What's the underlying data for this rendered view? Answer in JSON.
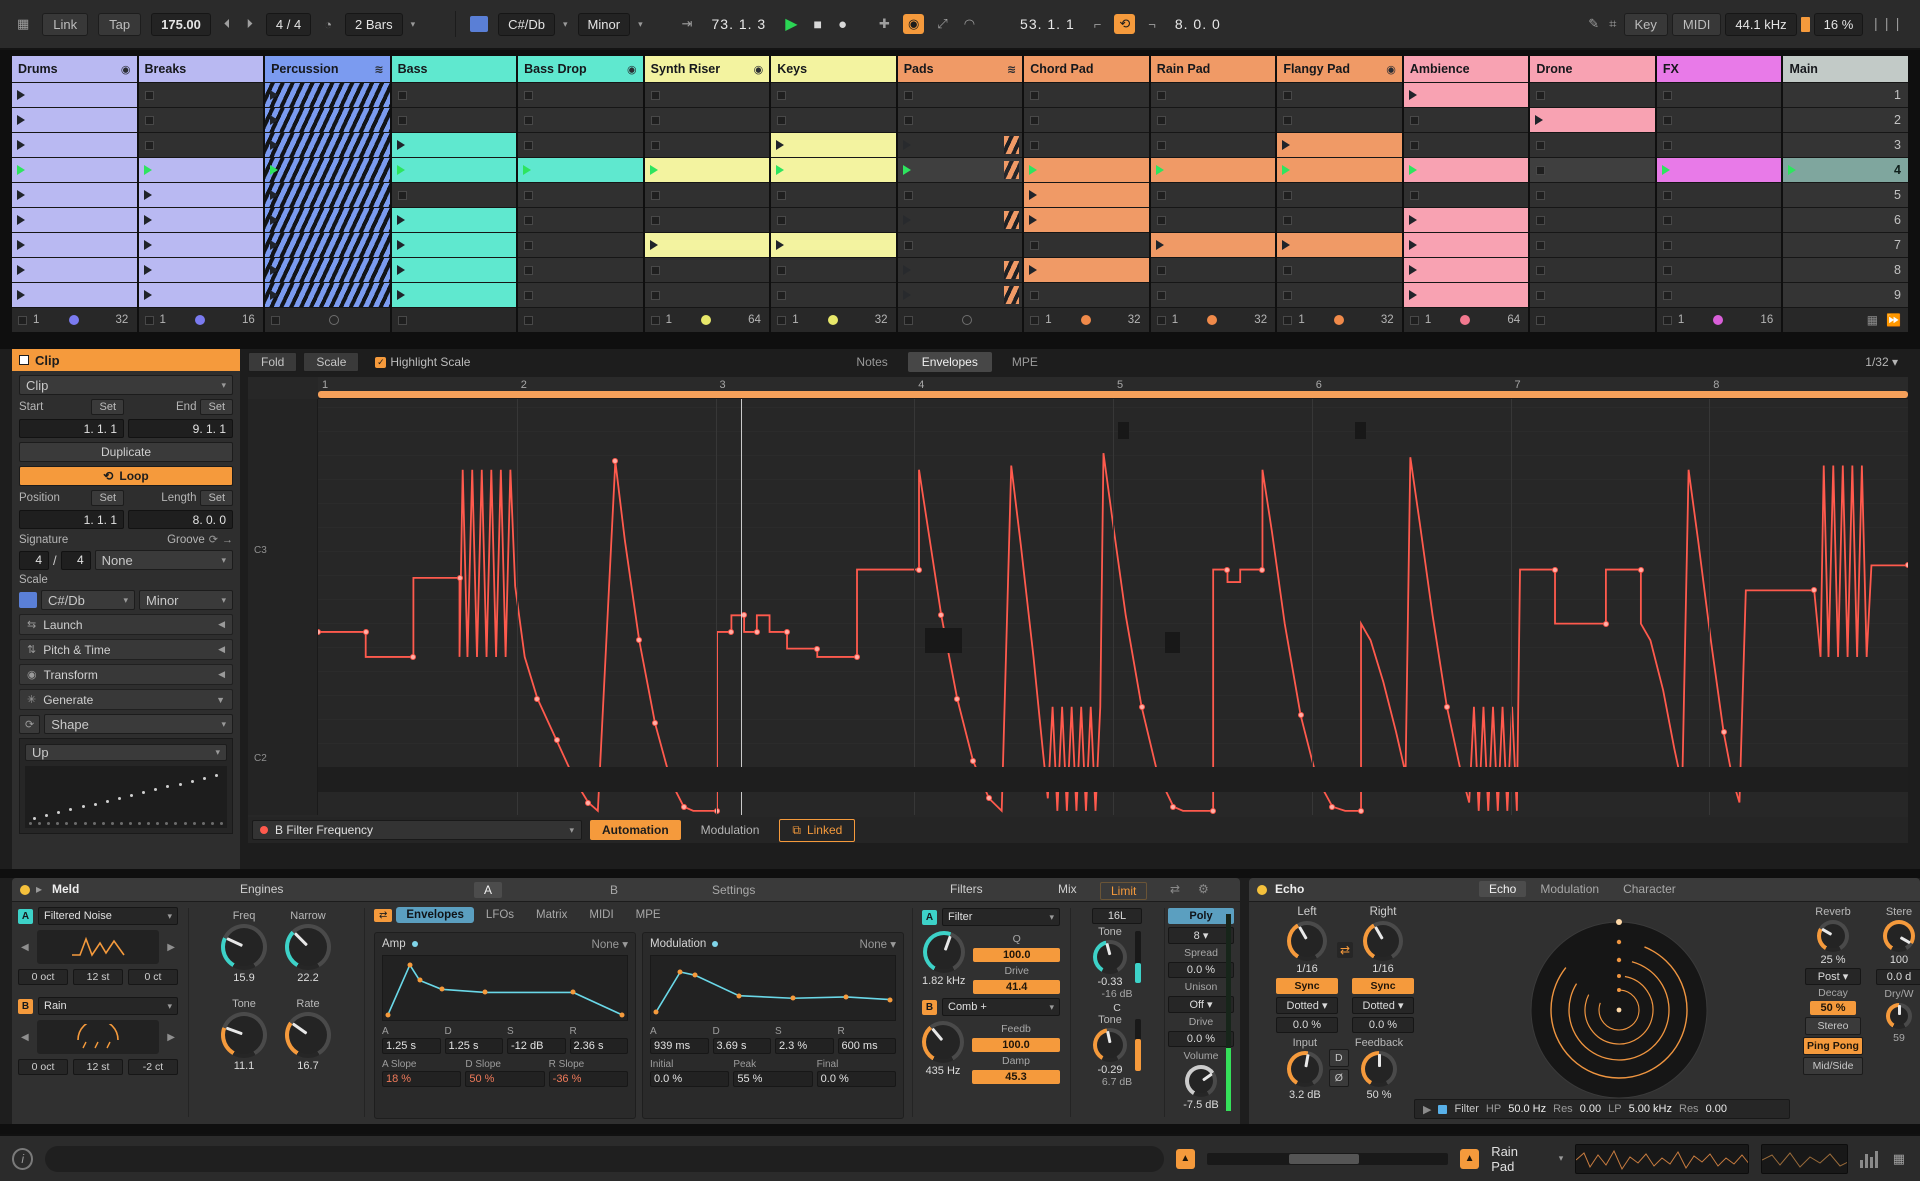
{
  "transport": {
    "link": "Link",
    "tap": "Tap",
    "tempo": "175.00",
    "sig": "4 / 4",
    "quantize": "2 Bars",
    "key_root": "C#/Db",
    "key_scale": "Minor",
    "arrange_pos": "73. 1. 3",
    "session_pos": "53. 1. 1",
    "loop_len": "8. 0. 0",
    "key": "Key",
    "midi": "MIDI",
    "rate": "44.1 kHz",
    "cpu": "16 %"
  },
  "session": {
    "tracks": [
      {
        "name": "Drums",
        "color": "#b9b9f2",
        "icon": "circle",
        "clips": [
          1,
          1,
          1,
          2,
          1,
          1,
          1,
          1,
          1
        ],
        "footer": {
          "type": "loop",
          "start": "1",
          "dot": "#7b7bf0",
          "len": "32"
        }
      },
      {
        "name": "Breaks",
        "color": "#b9b9f2",
        "icon": null,
        "clips": [
          0,
          0,
          0,
          2,
          1,
          1,
          1,
          1,
          1
        ],
        "footer": {
          "type": "loop",
          "start": "1",
          "dot": "#7b7bf0",
          "len": "16"
        }
      },
      {
        "name": "Percussion",
        "color": "#7b9bf0",
        "icon": "stripes",
        "clips": [
          3,
          3,
          3,
          4,
          3,
          3,
          3,
          3,
          3
        ],
        "footer": {
          "type": "circle"
        }
      },
      {
        "name": "Bass",
        "color": "#5fe8cf",
        "icon": null,
        "clips": [
          0,
          0,
          1,
          2,
          0,
          1,
          1,
          1,
          1
        ],
        "footer": {
          "type": "empty"
        }
      },
      {
        "name": "Bass Drop",
        "color": "#5fe8cf",
        "icon": "circle",
        "clips": [
          0,
          0,
          0,
          2,
          0,
          0,
          0,
          0,
          0
        ],
        "footer": {
          "type": "empty"
        }
      },
      {
        "name": "Synth Riser",
        "color": "#f3f3a0",
        "icon": "circle",
        "clips": [
          0,
          0,
          0,
          2,
          0,
          0,
          1,
          0,
          0
        ],
        "footer": {
          "type": "loop",
          "start": "1",
          "dot": "#e8e86a",
          "len": "64"
        }
      },
      {
        "name": "Keys",
        "color": "#f3f3a0",
        "icon": null,
        "clips": [
          0,
          0,
          1,
          2,
          0,
          0,
          1,
          0,
          0
        ],
        "footer": {
          "type": "loop",
          "start": "1",
          "dot": "#e8e86a",
          "len": "32"
        }
      },
      {
        "name": "Pads",
        "color": "#f09a66",
        "icon": "stripes",
        "clips": [
          0,
          0,
          5,
          6,
          0,
          5,
          0,
          5,
          5
        ],
        "footer": {
          "type": "circle"
        }
      },
      {
        "name": "Chord Pad",
        "color": "#f09a66",
        "icon": null,
        "clips": [
          0,
          0,
          0,
          2,
          1,
          1,
          0,
          1,
          0
        ],
        "footer": {
          "type": "loop",
          "start": "1",
          "dot": "#f08a4a",
          "len": "32"
        }
      },
      {
        "name": "Rain Pad",
        "color": "#f09a66",
        "icon": null,
        "clips": [
          0,
          0,
          0,
          2,
          0,
          0,
          1,
          0,
          0
        ],
        "footer": {
          "type": "loop",
          "start": "1",
          "dot": "#f08a4a",
          "len": "32"
        }
      },
      {
        "name": "Flangy Pad",
        "color": "#f09a66",
        "icon": "circle",
        "clips": [
          0,
          0,
          1,
          2,
          0,
          0,
          1,
          0,
          0
        ],
        "footer": {
          "type": "loop",
          "start": "1",
          "dot": "#f08a4a",
          "len": "32"
        }
      },
      {
        "name": "Ambience",
        "color": "#f8a2b2",
        "icon": null,
        "clips": [
          1,
          0,
          0,
          2,
          0,
          1,
          1,
          1,
          1
        ],
        "footer": {
          "type": "loop",
          "start": "1",
          "dot": "#f2798f",
          "len": "64"
        }
      },
      {
        "name": "Drone",
        "color": "#f8a2b2",
        "icon": null,
        "clips": [
          0,
          1,
          0,
          0,
          0,
          0,
          0,
          0,
          0
        ],
        "footer": {
          "type": "empty"
        }
      },
      {
        "name": "FX",
        "color": "#e87ae8",
        "icon": null,
        "clips": [
          0,
          0,
          0,
          2,
          0,
          0,
          0,
          0,
          0
        ],
        "footer": {
          "type": "loop",
          "start": "1",
          "dot": "#d95fd9",
          "len": "16"
        }
      }
    ],
    "main": {
      "name": "Main",
      "scenes": [
        "1",
        "2",
        "3",
        "4",
        "5",
        "6",
        "7",
        "8",
        "9"
      ],
      "selected": 3
    }
  },
  "editor": {
    "fold": "Fold",
    "scale": "Scale",
    "highlight": "Highlight Scale",
    "notes": "Notes",
    "envelopes": "Envelopes",
    "mpe": "MPE",
    "grid": "1/32"
  },
  "clip": {
    "title": "Clip",
    "tab": "Clip",
    "start": "Start",
    "set": "Set",
    "end": "End",
    "start_val": "1. 1. 1",
    "end_val": "9. 1. 1",
    "duplicate": "Duplicate",
    "loop": "Loop",
    "position": "Position",
    "length": "Length",
    "pos_val": "1. 1. 1",
    "len_val": "8. 0. 0",
    "signature": "Signature",
    "groove": "Groove",
    "sig_num": "4",
    "sig_div": "/",
    "sig_den": "4",
    "groove_val": "None",
    "scale_label": "Scale",
    "scale_root": "C#/Db",
    "scale_name": "Minor",
    "launch": "Launch",
    "pitch": "Pitch & Time",
    "transform": "Transform",
    "generate": "Generate",
    "shape": "Shape",
    "direction": "Up"
  },
  "envelope": {
    "bars": [
      "1",
      "2",
      "3",
      "4",
      "5",
      "6",
      "7",
      "8"
    ],
    "note_hi": "C3",
    "note_lo": "C2",
    "playhead": 26.6,
    "target": "B Filter Frequency",
    "automation": "Automation",
    "modulation": "Modulation",
    "linked": "Linked",
    "blocks": [
      [
        50.3,
        5.5,
        0.7,
        4
      ],
      [
        65.2,
        5.5,
        0.7,
        4
      ],
      [
        38.2,
        55,
        2.3,
        6
      ],
      [
        53.3,
        56,
        0.9,
        5
      ]
    ],
    "points": [
      [
        0,
        56
      ],
      [
        3,
        56
      ],
      [
        3,
        62
      ],
      [
        6,
        62
      ],
      [
        6,
        43
      ],
      [
        8.9,
        43
      ],
      [
        8.9,
        62
      ],
      [
        9.1,
        17
      ],
      [
        9.4,
        62
      ],
      [
        9.7,
        17
      ],
      [
        10,
        62
      ],
      [
        10.3,
        17
      ],
      [
        10.6,
        62
      ],
      [
        10.9,
        17
      ],
      [
        11.2,
        62
      ],
      [
        11.5,
        17
      ],
      [
        11.8,
        62
      ],
      [
        12.1,
        17
      ],
      [
        12.4,
        45
      ],
      [
        13,
        62
      ],
      [
        13.8,
        72
      ],
      [
        15,
        82
      ],
      [
        16.2,
        92
      ],
      [
        17,
        97
      ],
      [
        17.6,
        99
      ],
      [
        18.7,
        15
      ],
      [
        19.3,
        34
      ],
      [
        20.2,
        58
      ],
      [
        21.2,
        78
      ],
      [
        22.2,
        92
      ],
      [
        23,
        98
      ],
      [
        23.6,
        99
      ],
      [
        25.1,
        99
      ],
      [
        25.1,
        56
      ],
      [
        26,
        56
      ],
      [
        26,
        52
      ],
      [
        26.8,
        52
      ],
      [
        26.8,
        56
      ],
      [
        27.6,
        56
      ],
      [
        27.6,
        52
      ],
      [
        28.4,
        52
      ],
      [
        28.4,
        56
      ],
      [
        29.5,
        56
      ],
      [
        29.5,
        60
      ],
      [
        31.4,
        60
      ],
      [
        31.4,
        62
      ],
      [
        33.9,
        62
      ],
      [
        33.9,
        41
      ],
      [
        37.8,
        41
      ],
      [
        37.8,
        17
      ],
      [
        38.4,
        32
      ],
      [
        39.2,
        52
      ],
      [
        40.2,
        72
      ],
      [
        41.2,
        87
      ],
      [
        42.2,
        96
      ],
      [
        43,
        99
      ],
      [
        43.6,
        16
      ],
      [
        44.2,
        35
      ],
      [
        45,
        62
      ],
      [
        45.6,
        85
      ],
      [
        45.9,
        96
      ],
      [
        46.2,
        74
      ],
      [
        46.5,
        99
      ],
      [
        46.8,
        74
      ],
      [
        47.1,
        99
      ],
      [
        47.4,
        74
      ],
      [
        47.7,
        99
      ],
      [
        48,
        74
      ],
      [
        48.3,
        99
      ],
      [
        48.6,
        74
      ],
      [
        48.9,
        99
      ],
      [
        49.2,
        74
      ],
      [
        49.4,
        13
      ],
      [
        50,
        30
      ],
      [
        50.8,
        52
      ],
      [
        51.8,
        74
      ],
      [
        52.8,
        90
      ],
      [
        53.8,
        98
      ],
      [
        54.4,
        99
      ],
      [
        56.3,
        99
      ],
      [
        56.3,
        41
      ],
      [
        57.2,
        41
      ],
      [
        57.2,
        44
      ],
      [
        58,
        44
      ],
      [
        58,
        41
      ],
      [
        59.4,
        41
      ],
      [
        59.4,
        17
      ],
      [
        60,
        32
      ],
      [
        60.8,
        54
      ],
      [
        61.8,
        76
      ],
      [
        62.8,
        91
      ],
      [
        63.8,
        98
      ],
      [
        64.6,
        99
      ],
      [
        65.6,
        99
      ],
      [
        65.6,
        54
      ],
      [
        66.2,
        58
      ],
      [
        67,
        68
      ],
      [
        67.8,
        80
      ],
      [
        68.4,
        90
      ],
      [
        68.7,
        14
      ],
      [
        69.3,
        30
      ],
      [
        70.1,
        52
      ],
      [
        71,
        74
      ],
      [
        71.9,
        90
      ],
      [
        72.4,
        97
      ],
      [
        72.7,
        74
      ],
      [
        73,
        99
      ],
      [
        73.3,
        74
      ],
      [
        73.6,
        99
      ],
      [
        73.9,
        74
      ],
      [
        74.2,
        99
      ],
      [
        74.5,
        74
      ],
      [
        74.8,
        99
      ],
      [
        75.1,
        74
      ],
      [
        75.4,
        99
      ],
      [
        75.6,
        41
      ],
      [
        77.8,
        41
      ],
      [
        77.8,
        54
      ],
      [
        81,
        54
      ],
      [
        81,
        41
      ],
      [
        83.2,
        41
      ],
      [
        83.2,
        54
      ],
      [
        83.8,
        58
      ],
      [
        84.6,
        70
      ],
      [
        85.3,
        84
      ],
      [
        85.8,
        93
      ],
      [
        86.2,
        17
      ],
      [
        86.8,
        34
      ],
      [
        87.6,
        58
      ],
      [
        88.4,
        80
      ],
      [
        89,
        92
      ],
      [
        89.4,
        97
      ],
      [
        89.8,
        46
      ],
      [
        94.1,
        46
      ],
      [
        94.5,
        62
      ],
      [
        94.7,
        16
      ],
      [
        95,
        62
      ],
      [
        95.3,
        16
      ],
      [
        95.6,
        62
      ],
      [
        95.9,
        16
      ],
      [
        96.2,
        62
      ],
      [
        96.5,
        16
      ],
      [
        96.8,
        62
      ],
      [
        97.1,
        16
      ],
      [
        97.4,
        62
      ],
      [
        97.7,
        40
      ],
      [
        100,
        40
      ]
    ]
  },
  "meld": {
    "title": "Meld",
    "engines": "Engines",
    "tab_a": "A",
    "tab_b": "B",
    "settings": "Settings",
    "filters": "Filters",
    "mix": "Mix",
    "limit": "Limit",
    "a": {
      "badge": "A",
      "name": "Filtered Noise",
      "oct": "0 oct",
      "semi": "12 st",
      "cent": "0 ct",
      "knob1": {
        "label": "Freq",
        "value": "15.9",
        "a": -65,
        "rc": "#3dd2c8"
      },
      "knob2": {
        "label": "Narrow",
        "value": "22.2",
        "a": -45,
        "rc": "#3dd2c8"
      }
    },
    "b": {
      "badge": "B",
      "name": "Rain",
      "oct": "0 oct",
      "semi": "12 st",
      "cent": "-2 ct",
      "knob1": {
        "label": "Tone",
        "value": "11.1",
        "a": -70,
        "rc": "#f59a3c"
      },
      "knob2": {
        "label": "Rate",
        "value": "16.7",
        "a": -55,
        "rc": "#f59a3c"
      }
    },
    "mod_tabs": [
      "Envelopes",
      "LFOs",
      "Matrix",
      "MIDI",
      "MPE"
    ],
    "amp": {
      "label": "Amp",
      "route": "None",
      "vals": [
        {
          "l": "A",
          "v": "1.25 s"
        },
        {
          "l": "D",
          "v": "1.25 s"
        },
        {
          "l": "S",
          "v": "-12 dB"
        },
        {
          "l": "R",
          "v": "2.36 s"
        }
      ],
      "vals2": [
        {
          "l": "A Slope",
          "v": "18 %"
        },
        {
          "l": "D Slope",
          "v": "50 %"
        },
        {
          "l": "R Slope",
          "v": "-36 %"
        }
      ],
      "points": [
        [
          2,
          92
        ],
        [
          11,
          14
        ],
        [
          15,
          38
        ],
        [
          24,
          52
        ],
        [
          42,
          57
        ],
        [
          78,
          57
        ],
        [
          98,
          92
        ]
      ]
    },
    "modenv": {
      "label": "Modulation",
      "route": "None",
      "vals": [
        {
          "l": "A",
          "v": "939 ms"
        },
        {
          "l": "D",
          "v": "3.69 s"
        },
        {
          "l": "S",
          "v": "2.3 %"
        },
        {
          "l": "R",
          "v": "600 ms"
        }
      ],
      "vals2": [
        {
          "l": "Initial",
          "v": "0.0 %"
        },
        {
          "l": "Peak",
          "v": "55 %"
        },
        {
          "l": "Final",
          "v": "0.0 %"
        }
      ],
      "points": [
        [
          2,
          88
        ],
        [
          12,
          25
        ],
        [
          18,
          30
        ],
        [
          36,
          62
        ],
        [
          58,
          66
        ],
        [
          80,
          64
        ],
        [
          98,
          68
        ]
      ]
    },
    "fa": {
      "badge": "A",
      "type": "Filter",
      "freq": "1.82 kHz",
      "q": "Q",
      "qv": "100.0",
      "drive": "Drive",
      "drivev": "41.4",
      "knob": {
        "a": 20,
        "rc": "#3dd2c8"
      }
    },
    "fb": {
      "badge": "B",
      "type": "Comb +",
      "freq": "435 Hz",
      "fbl": "Feedb",
      "fbv": "100.0",
      "damp": "Damp",
      "dampv": "45.3",
      "knob": {
        "a": -40,
        "rc": "#f59a3c"
      }
    },
    "route": "16L",
    "c": "C",
    "tone1": {
      "label": "Tone",
      "value": "-0.33",
      "db": "-16 dB",
      "knob": {
        "a": -15,
        "rc": "#3dd2c8"
      }
    },
    "tone2": {
      "label": "Tone",
      "value": "-0.29",
      "db": "6.7 dB",
      "knob": {
        "a": -12,
        "rc": "#f59a3c"
      }
    },
    "mixer": {
      "poly": "Poly",
      "voices": "8",
      "spread": "Spread",
      "spread_v": "0.0 %",
      "unison": "Unison",
      "unison_v": "Off",
      "drive": "Drive",
      "drive_v": "0.0 %",
      "volume": "Volume",
      "volume_v": "-7.5 dB",
      "knob": {
        "a": 55,
        "rc": "#cccccc"
      }
    }
  },
  "echo": {
    "title": "Echo",
    "tabs": [
      "Echo",
      "Modulation",
      "Character"
    ],
    "left": {
      "label": "Left",
      "time": "1/16",
      "sync": "Sync",
      "mode": "Dotted",
      "offset": "0.0 %",
      "knob": {
        "a": -30,
        "rc": "#f59a3c"
      }
    },
    "right": {
      "label": "Right",
      "time": "1/16",
      "sync": "Sync",
      "mode": "Dotted",
      "offset": "0.0 %",
      "knob": {
        "a": -30,
        "rc": "#f59a3c"
      }
    },
    "input": {
      "label": "Input",
      "value": "3.2 dB",
      "knob": {
        "a": 10,
        "rc": "#f59a3c"
      }
    },
    "feedback": {
      "label": "Feedback",
      "value": "50 %",
      "knob": {
        "a": 0,
        "rc": "#f59a3c"
      }
    },
    "d": "D",
    "phase": "Ø",
    "bar": {
      "filter": "Filter",
      "hp": "HP",
      "hpv": "50.0 Hz",
      "res": "Res",
      "resv": "0.00",
      "lp": "LP",
      "lpv": "5.00 kHz",
      "res2": "Res",
      "res2v": "0.00"
    },
    "reverb": {
      "label": "Reverb",
      "value": "25 %",
      "knob": {
        "a": -60,
        "rc": "#f59a3c"
      }
    },
    "stereo": {
      "label": "Stere",
      "value": "100",
      "knob": {
        "a": 120,
        "rc": "#f59a3c"
      }
    },
    "post": "Post",
    "decay": {
      "label": "Decay",
      "value": "50 %",
      "knob": {
        "a": 0,
        "rc": "#f59a3c"
      }
    },
    "outv": "0.0 d",
    "stereo_btn": "Stereo",
    "dryw": "Dry/W",
    "pingpong": "Ping Pong",
    "midside": "Mid/Side",
    "p59": "59"
  },
  "status": {
    "track": "Rain Pad"
  }
}
